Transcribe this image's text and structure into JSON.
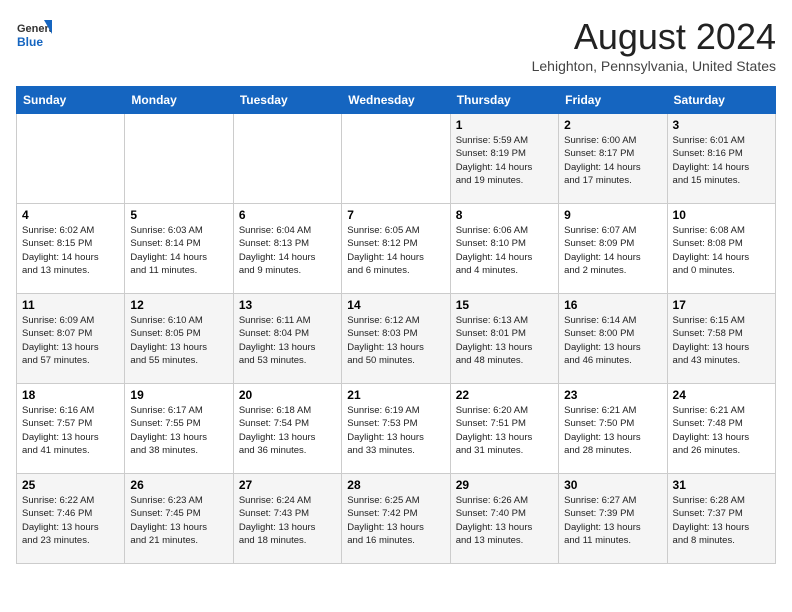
{
  "header": {
    "logo_line1": "General",
    "logo_line2": "Blue",
    "month_year": "August 2024",
    "location": "Lehighton, Pennsylvania, United States"
  },
  "days_of_week": [
    "Sunday",
    "Monday",
    "Tuesday",
    "Wednesday",
    "Thursday",
    "Friday",
    "Saturday"
  ],
  "weeks": [
    [
      {
        "day": "",
        "info": ""
      },
      {
        "day": "",
        "info": ""
      },
      {
        "day": "",
        "info": ""
      },
      {
        "day": "",
        "info": ""
      },
      {
        "day": "1",
        "info": "Sunrise: 5:59 AM\nSunset: 8:19 PM\nDaylight: 14 hours\nand 19 minutes."
      },
      {
        "day": "2",
        "info": "Sunrise: 6:00 AM\nSunset: 8:17 PM\nDaylight: 14 hours\nand 17 minutes."
      },
      {
        "day": "3",
        "info": "Sunrise: 6:01 AM\nSunset: 8:16 PM\nDaylight: 14 hours\nand 15 minutes."
      }
    ],
    [
      {
        "day": "4",
        "info": "Sunrise: 6:02 AM\nSunset: 8:15 PM\nDaylight: 14 hours\nand 13 minutes."
      },
      {
        "day": "5",
        "info": "Sunrise: 6:03 AM\nSunset: 8:14 PM\nDaylight: 14 hours\nand 11 minutes."
      },
      {
        "day": "6",
        "info": "Sunrise: 6:04 AM\nSunset: 8:13 PM\nDaylight: 14 hours\nand 9 minutes."
      },
      {
        "day": "7",
        "info": "Sunrise: 6:05 AM\nSunset: 8:12 PM\nDaylight: 14 hours\nand 6 minutes."
      },
      {
        "day": "8",
        "info": "Sunrise: 6:06 AM\nSunset: 8:10 PM\nDaylight: 14 hours\nand 4 minutes."
      },
      {
        "day": "9",
        "info": "Sunrise: 6:07 AM\nSunset: 8:09 PM\nDaylight: 14 hours\nand 2 minutes."
      },
      {
        "day": "10",
        "info": "Sunrise: 6:08 AM\nSunset: 8:08 PM\nDaylight: 14 hours\nand 0 minutes."
      }
    ],
    [
      {
        "day": "11",
        "info": "Sunrise: 6:09 AM\nSunset: 8:07 PM\nDaylight: 13 hours\nand 57 minutes."
      },
      {
        "day": "12",
        "info": "Sunrise: 6:10 AM\nSunset: 8:05 PM\nDaylight: 13 hours\nand 55 minutes."
      },
      {
        "day": "13",
        "info": "Sunrise: 6:11 AM\nSunset: 8:04 PM\nDaylight: 13 hours\nand 53 minutes."
      },
      {
        "day": "14",
        "info": "Sunrise: 6:12 AM\nSunset: 8:03 PM\nDaylight: 13 hours\nand 50 minutes."
      },
      {
        "day": "15",
        "info": "Sunrise: 6:13 AM\nSunset: 8:01 PM\nDaylight: 13 hours\nand 48 minutes."
      },
      {
        "day": "16",
        "info": "Sunrise: 6:14 AM\nSunset: 8:00 PM\nDaylight: 13 hours\nand 46 minutes."
      },
      {
        "day": "17",
        "info": "Sunrise: 6:15 AM\nSunset: 7:58 PM\nDaylight: 13 hours\nand 43 minutes."
      }
    ],
    [
      {
        "day": "18",
        "info": "Sunrise: 6:16 AM\nSunset: 7:57 PM\nDaylight: 13 hours\nand 41 minutes."
      },
      {
        "day": "19",
        "info": "Sunrise: 6:17 AM\nSunset: 7:55 PM\nDaylight: 13 hours\nand 38 minutes."
      },
      {
        "day": "20",
        "info": "Sunrise: 6:18 AM\nSunset: 7:54 PM\nDaylight: 13 hours\nand 36 minutes."
      },
      {
        "day": "21",
        "info": "Sunrise: 6:19 AM\nSunset: 7:53 PM\nDaylight: 13 hours\nand 33 minutes."
      },
      {
        "day": "22",
        "info": "Sunrise: 6:20 AM\nSunset: 7:51 PM\nDaylight: 13 hours\nand 31 minutes."
      },
      {
        "day": "23",
        "info": "Sunrise: 6:21 AM\nSunset: 7:50 PM\nDaylight: 13 hours\nand 28 minutes."
      },
      {
        "day": "24",
        "info": "Sunrise: 6:21 AM\nSunset: 7:48 PM\nDaylight: 13 hours\nand 26 minutes."
      }
    ],
    [
      {
        "day": "25",
        "info": "Sunrise: 6:22 AM\nSunset: 7:46 PM\nDaylight: 13 hours\nand 23 minutes."
      },
      {
        "day": "26",
        "info": "Sunrise: 6:23 AM\nSunset: 7:45 PM\nDaylight: 13 hours\nand 21 minutes."
      },
      {
        "day": "27",
        "info": "Sunrise: 6:24 AM\nSunset: 7:43 PM\nDaylight: 13 hours\nand 18 minutes."
      },
      {
        "day": "28",
        "info": "Sunrise: 6:25 AM\nSunset: 7:42 PM\nDaylight: 13 hours\nand 16 minutes."
      },
      {
        "day": "29",
        "info": "Sunrise: 6:26 AM\nSunset: 7:40 PM\nDaylight: 13 hours\nand 13 minutes."
      },
      {
        "day": "30",
        "info": "Sunrise: 6:27 AM\nSunset: 7:39 PM\nDaylight: 13 hours\nand 11 minutes."
      },
      {
        "day": "31",
        "info": "Sunrise: 6:28 AM\nSunset: 7:37 PM\nDaylight: 13 hours\nand 8 minutes."
      }
    ]
  ]
}
